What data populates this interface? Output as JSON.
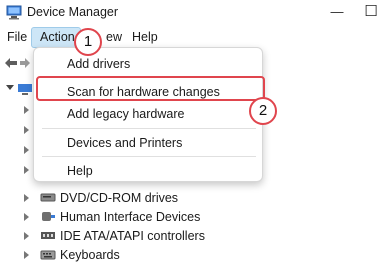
{
  "window": {
    "title": "Device Manager",
    "minimize_glyph": "—",
    "restore_glyph": "☐"
  },
  "menubar": {
    "items": [
      "File",
      "Action",
      "View",
      "Help"
    ],
    "view_visible": "ew"
  },
  "dropdown": {
    "items": [
      {
        "label": "Add drivers"
      },
      {
        "label": "Scan for hardware changes"
      },
      {
        "label": "Add legacy hardware"
      },
      {
        "label": "Devices and Printers"
      },
      {
        "label": "Help"
      }
    ]
  },
  "tree": {
    "items": [
      {
        "label": "DVD/CD-ROM drives",
        "icon": "dvd-drive-icon"
      },
      {
        "label": "Human Interface Devices",
        "icon": "hid-icon"
      },
      {
        "label": "IDE ATA/ATAPI controllers",
        "icon": "ide-controller-icon"
      },
      {
        "label": "Keyboards",
        "icon": "keyboard-icon"
      }
    ]
  },
  "annotations": {
    "step1": "1",
    "step2": "2",
    "color": "#e0454d"
  },
  "colors": {
    "menu_hover": "#cde6f7",
    "dropdown_bg": "#ffffff"
  }
}
